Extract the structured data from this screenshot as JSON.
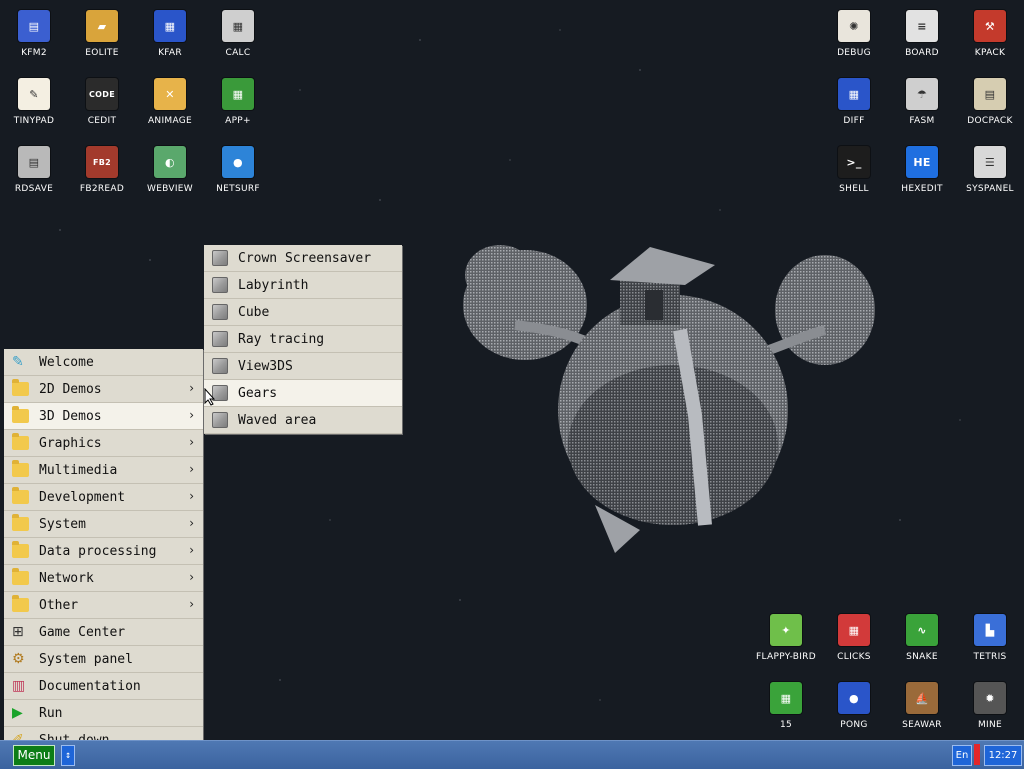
{
  "desktop": {
    "left_icons": [
      {
        "label": "KFM2",
        "color": "#3b5fd0",
        "glyph": "▤"
      },
      {
        "label": "EOLITE",
        "color": "#d9a43b",
        "glyph": "▰"
      },
      {
        "label": "KFAR",
        "color": "#2a55c9",
        "glyph": "▦"
      },
      {
        "label": "CALC",
        "color": "#cfcfcf",
        "glyph": "▦"
      },
      {
        "label": "TINYPAD",
        "color": "#f4efe2",
        "glyph": "✎"
      },
      {
        "label": "CEDIT",
        "color": "#2b2b2b",
        "glyph": "CODE"
      },
      {
        "label": "ANIMAGE",
        "color": "#e7b34a",
        "glyph": "✕"
      },
      {
        "label": "APP+",
        "color": "#3a9a3a",
        "glyph": "▦"
      },
      {
        "label": "RDSAVE",
        "color": "#b9b9b9",
        "glyph": "▤"
      },
      {
        "label": "FB2READ",
        "color": "#a33a2c",
        "glyph": "FB2"
      },
      {
        "label": "WEBVIEW",
        "color": "#5aa86c",
        "glyph": "◐"
      },
      {
        "label": "NETSURF",
        "color": "#2d84d8",
        "glyph": "●"
      }
    ],
    "right_icons": [
      {
        "label": "DEBUG",
        "color": "#e9e5dc",
        "glyph": "✺"
      },
      {
        "label": "BOARD",
        "color": "#e2e2e2",
        "glyph": "≡"
      },
      {
        "label": "KPACK",
        "color": "#c43a2c",
        "glyph": "⚒"
      },
      {
        "label": "DIFF",
        "color": "#2a55c9",
        "glyph": "▦"
      },
      {
        "label": "FASM",
        "color": "#cfcfcf",
        "glyph": "☂"
      },
      {
        "label": "DOCPACK",
        "color": "#d6cdb1",
        "glyph": "▤"
      },
      {
        "label": "SHELL",
        "color": "#1d1d1d",
        "glyph": ">_"
      },
      {
        "label": "HEXEDIT",
        "color": "#1f6fe0",
        "glyph": "HE"
      },
      {
        "label": "SYSPANEL",
        "color": "#d8d8d8",
        "glyph": "☰"
      }
    ],
    "game_icons": [
      {
        "label": "FLAPPY-BIRD",
        "color": "#6fbf4a",
        "glyph": "✦"
      },
      {
        "label": "CLICKS",
        "color": "#d23a3a",
        "glyph": "▦"
      },
      {
        "label": "SNAKE",
        "color": "#3aa33a",
        "glyph": "∿"
      },
      {
        "label": "TETRIS",
        "color": "#3a6fd8",
        "glyph": "▙"
      },
      {
        "label": "15",
        "color": "#3aa33a",
        "glyph": "▦"
      },
      {
        "label": "PONG",
        "color": "#2a55c9",
        "glyph": "●"
      },
      {
        "label": "SEAWAR",
        "color": "#9a6a3a",
        "glyph": "⛵"
      },
      {
        "label": "MINE",
        "color": "#555555",
        "glyph": "✹"
      }
    ]
  },
  "main_menu": [
    {
      "label": "Welcome",
      "icon": "welcome-icon",
      "submenu": false
    },
    {
      "label": "2D Demos",
      "icon": "folder-icon",
      "submenu": true
    },
    {
      "label": "3D Demos",
      "icon": "folder-icon",
      "submenu": true,
      "selected": true
    },
    {
      "label": "Graphics",
      "icon": "folder-icon",
      "submenu": true
    },
    {
      "label": "Multimedia",
      "icon": "folder-icon",
      "submenu": true
    },
    {
      "label": "Development",
      "icon": "folder-icon",
      "submenu": true
    },
    {
      "label": "System",
      "icon": "folder-icon",
      "submenu": true
    },
    {
      "label": "Data processing",
      "icon": "folder-icon",
      "submenu": true
    },
    {
      "label": "Network",
      "icon": "folder-icon",
      "submenu": true
    },
    {
      "label": "Other",
      "icon": "folder-icon",
      "submenu": true
    },
    {
      "label": "Game Center",
      "icon": "gamepad-icon",
      "submenu": false
    },
    {
      "label": "System panel",
      "icon": "gears-icon",
      "submenu": false
    },
    {
      "label": "Documentation",
      "icon": "books-icon",
      "submenu": false
    },
    {
      "label": "Run",
      "icon": "play-icon",
      "submenu": false
    },
    {
      "label": "Shut down",
      "icon": "shutdown-icon",
      "submenu": false
    }
  ],
  "sub_menu": [
    {
      "label": "Crown Screensaver"
    },
    {
      "label": "Labyrinth"
    },
    {
      "label": "Cube"
    },
    {
      "label": "Ray tracing"
    },
    {
      "label": "View3DS"
    },
    {
      "label": "Gears",
      "selected": true
    },
    {
      "label": "Waved area"
    }
  ],
  "taskbar": {
    "menu_label": "Menu",
    "switch_glyph": "↕",
    "lang": "En",
    "clock": "12:27"
  }
}
